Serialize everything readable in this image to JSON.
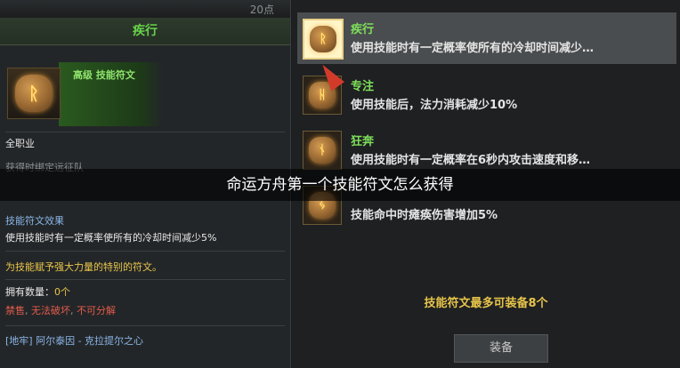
{
  "left_panel": {
    "top_count": "20点",
    "title": "疾行",
    "grade_label": "高级 技能符文",
    "class_label": "全职业",
    "bind_label": "获得时绑定远征队",
    "effect_heading": "技能符文效果",
    "effect_text": "使用技能时有一定概率使所有的冷却时间减少5%",
    "flavor_text": "为技能赋予强大力量的特别的符文。",
    "owned_label": "拥有数量：",
    "owned_value": "0个",
    "restriction_1": "禁售",
    "restriction_2": "无法破坏",
    "restriction_3": "不可分解",
    "source_text": "[地牢] 阿尔泰因 - 克拉提尔之心"
  },
  "right_panel": {
    "runes": [
      {
        "name": "疾行",
        "desc": "使用技能时有一定概率使所有的冷却时间减少…",
        "selected": true,
        "glyph": "ᚱ"
      },
      {
        "name": "专注",
        "desc": "使用技能后，法力消耗减少10%",
        "selected": false,
        "glyph": "ᚺ"
      },
      {
        "name": "狂奔",
        "desc": "使用技能时有一定概率在6秒内攻击速度和移…",
        "selected": false,
        "glyph": "ᚾ"
      },
      {
        "name": "",
        "desc": "技能命中时瘫痪伤害增加5%",
        "selected": false,
        "glyph": "ᛃ"
      }
    ],
    "max_info": "技能符文最多可装备8个",
    "equip_button": "装备"
  },
  "caption": "命运方舟第一个技能符文怎么获得",
  "colors": {
    "accent_green": "#67d24a",
    "highlight_yellow": "#e8c54a",
    "warning_red": "#e25c4b",
    "link_blue": "#8ab6e8"
  },
  "icons": {
    "rune": "rune-icon",
    "cursor": "cursor-arrow-icon"
  }
}
